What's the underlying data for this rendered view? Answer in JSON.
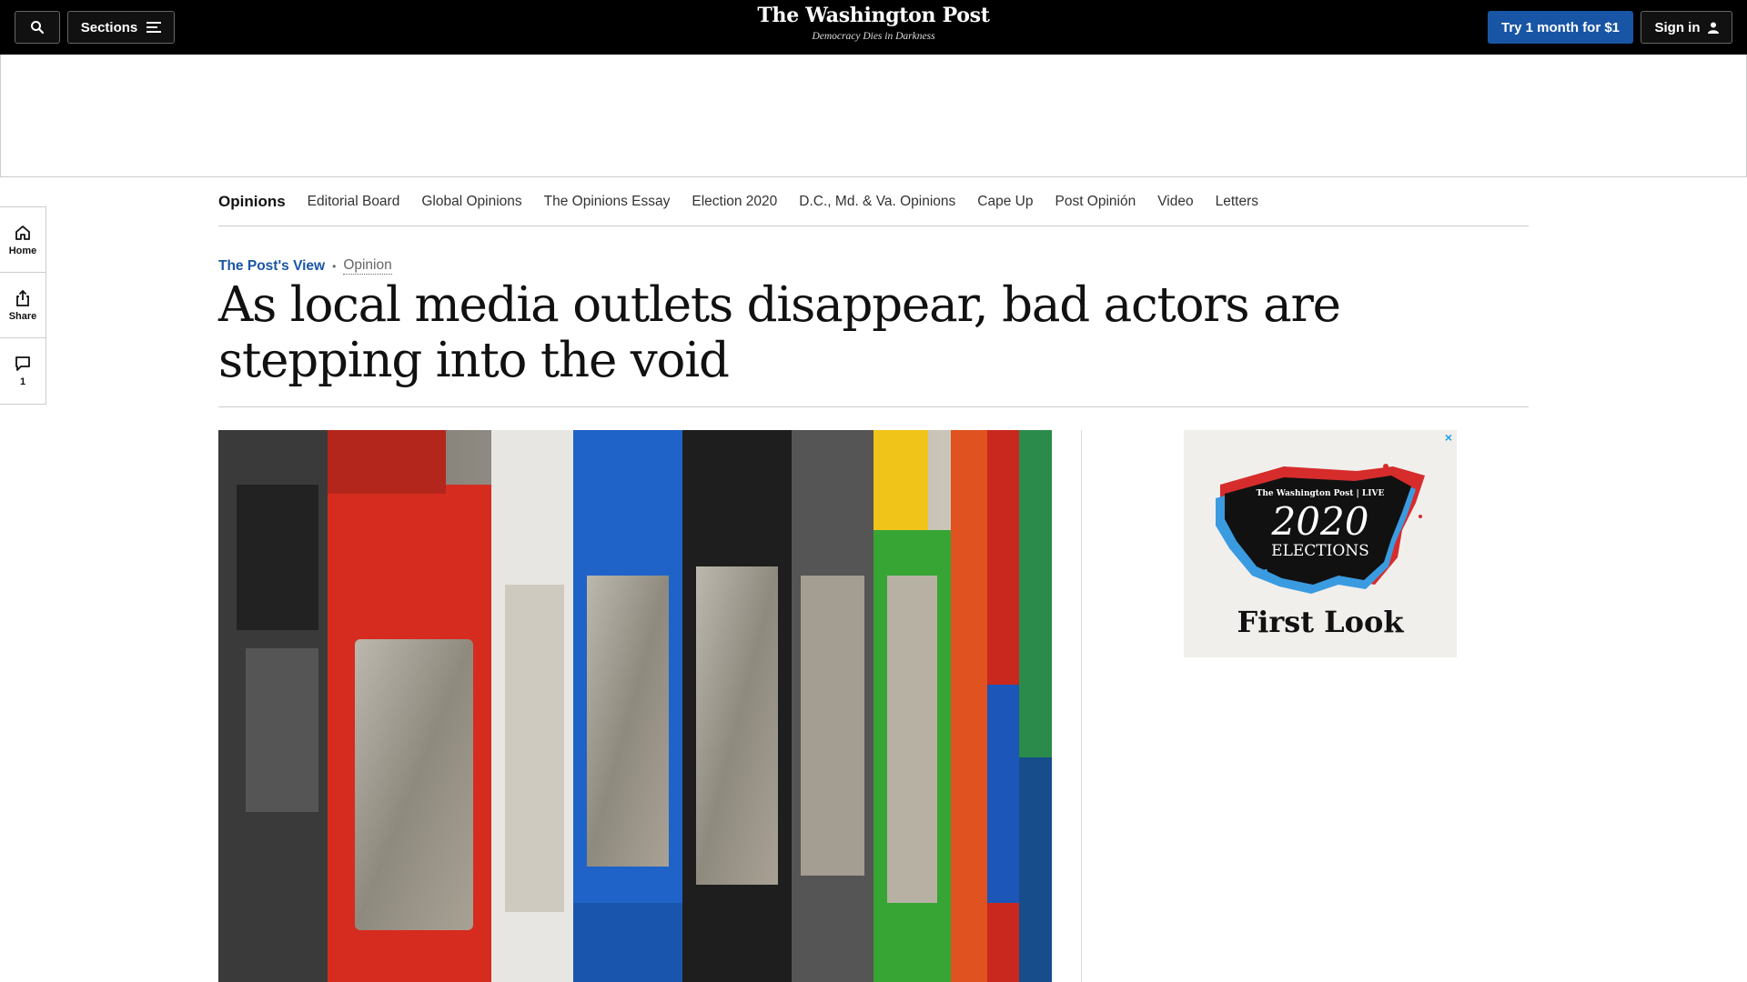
{
  "header": {
    "sections_label": "Sections",
    "logo_text": "The Washington Post",
    "tagline": "Democracy Dies in Darkness",
    "subscribe_label": "Try 1 month for $1",
    "signin_label": "Sign in"
  },
  "section_nav": {
    "primary": "Opinions",
    "items": [
      "Editorial Board",
      "Global Opinions",
      "The Opinions Essay",
      "Election 2020",
      "D.C., Md. & Va. Opinions",
      "Cape Up",
      "Post Opinión",
      "Video",
      "Letters"
    ]
  },
  "rail": {
    "home_label": "Home",
    "share_label": "Share",
    "comment_count": "1"
  },
  "article": {
    "kicker_label": "The Post's View",
    "kicker_separator": "•",
    "kicker_section": "Opinion",
    "headline": "As local media outlets disappear, bad actors are stepping into the void"
  },
  "ad": {
    "brand": "The Washington Post | LIVE",
    "year": "2020",
    "title": "ELECTIONS",
    "subtitle": "First Look",
    "close_symbol": "×"
  },
  "colors": {
    "accent_blue": "#1955a5",
    "topbar": "#000000"
  }
}
